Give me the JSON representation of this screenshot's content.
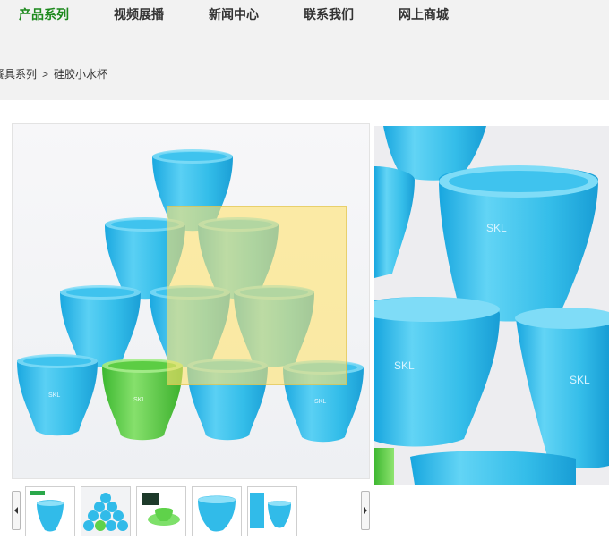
{
  "nav": {
    "items": [
      {
        "label": "产品系列",
        "active": true
      },
      {
        "label": "视频展播",
        "active": false
      },
      {
        "label": "新闻中心",
        "active": false
      },
      {
        "label": "联系我们",
        "active": false
      },
      {
        "label": "网上商城",
        "active": false
      }
    ]
  },
  "breadcrumb": {
    "parent": "餐具系列",
    "separator": ">",
    "current": "硅胶小水杯"
  },
  "product": {
    "brand_mark": "SKL"
  },
  "colors": {
    "nav_active": "#1e8a1e",
    "cup_blue": "#2fb8e8",
    "cup_green": "#5fd24a",
    "zoom_lens": "#ffe26e"
  }
}
